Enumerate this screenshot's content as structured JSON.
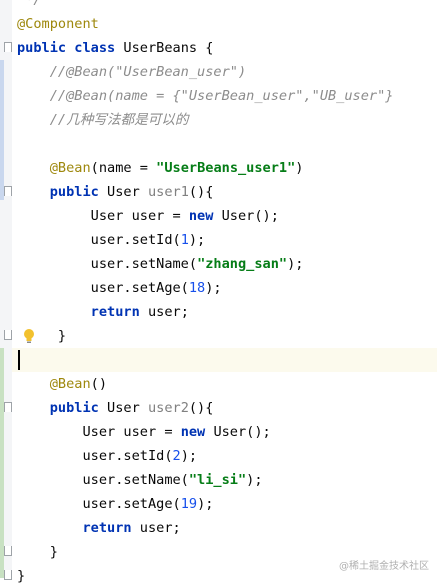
{
  "editor": {
    "lines": [
      [
        {
          "t": " */",
          "c": "cm"
        }
      ],
      [
        {
          "t": "@Component",
          "c": "ann"
        }
      ],
      [
        {
          "t": "public ",
          "c": "kw"
        },
        {
          "t": "class ",
          "c": "kw"
        },
        {
          "t": "UserBeans {",
          "c": "pln"
        }
      ],
      [
        {
          "t": "    //@Bean(\"UserBean_user\")",
          "c": "cm"
        }
      ],
      [
        {
          "t": "    //@Bean(name = {\"UserBean_user\",\"UB_user\"}",
          "c": "cm"
        }
      ],
      [
        {
          "t": "    //几种写法都是可以的",
          "c": "cm"
        }
      ],
      [],
      [
        {
          "t": "    @Bean",
          "c": "ann"
        },
        {
          "t": "(name = ",
          "c": "pln"
        },
        {
          "t": "\"UserBeans_user1\"",
          "c": "str"
        },
        {
          "t": ")",
          "c": "pln"
        }
      ],
      [
        {
          "t": "    public ",
          "c": "kw"
        },
        {
          "t": "User ",
          "c": "pln"
        },
        {
          "t": "user1",
          "c": "unused"
        },
        {
          "t": "(){",
          "c": "pln"
        }
      ],
      [
        {
          "t": "         User user = ",
          "c": "pln"
        },
        {
          "t": "new ",
          "c": "kw"
        },
        {
          "t": "User();",
          "c": "pln"
        }
      ],
      [
        {
          "t": "         user.setId(",
          "c": "pln"
        },
        {
          "t": "1",
          "c": "num"
        },
        {
          "t": ");",
          "c": "pln"
        }
      ],
      [
        {
          "t": "         user.setName(",
          "c": "pln"
        },
        {
          "t": "\"zhang_san\"",
          "c": "str"
        },
        {
          "t": ");",
          "c": "pln"
        }
      ],
      [
        {
          "t": "         user.setAge(",
          "c": "pln"
        },
        {
          "t": "18",
          "c": "num"
        },
        {
          "t": ");",
          "c": "pln"
        }
      ],
      [
        {
          "t": "         return ",
          "c": "kw"
        },
        {
          "t": "user;",
          "c": "pln"
        }
      ],
      [
        {
          "t": "     }",
          "c": "pln"
        }
      ],
      [],
      [
        {
          "t": "    @Bean",
          "c": "ann"
        },
        {
          "t": "()",
          "c": "pln"
        }
      ],
      [
        {
          "t": "    public ",
          "c": "kw"
        },
        {
          "t": "User ",
          "c": "pln"
        },
        {
          "t": "user2",
          "c": "unused"
        },
        {
          "t": "(){",
          "c": "pln"
        }
      ],
      [
        {
          "t": "        User user = ",
          "c": "pln"
        },
        {
          "t": "new ",
          "c": "kw"
        },
        {
          "t": "User();",
          "c": "pln"
        }
      ],
      [
        {
          "t": "        user.setId(",
          "c": "pln"
        },
        {
          "t": "2",
          "c": "num"
        },
        {
          "t": ");",
          "c": "pln"
        }
      ],
      [
        {
          "t": "        user.setName(",
          "c": "pln"
        },
        {
          "t": "\"li_si\"",
          "c": "str"
        },
        {
          "t": ");",
          "c": "pln"
        }
      ],
      [
        {
          "t": "        user.setAge(",
          "c": "pln"
        },
        {
          "t": "19",
          "c": "num"
        },
        {
          "t": ");",
          "c": "pln"
        }
      ],
      [
        {
          "t": "        return ",
          "c": "kw"
        },
        {
          "t": "user;",
          "c": "pln"
        }
      ],
      [
        {
          "t": "    }",
          "c": "pln"
        }
      ],
      [
        {
          "t": "}",
          "c": "pln"
        }
      ]
    ],
    "caret_line_index": 15,
    "intention_bulb_line_index": 14
  },
  "icons": {
    "gutter_fold": "fold-marker-icon",
    "intention": "lightbulb-icon"
  },
  "colors": {
    "keyword": "#0033b3",
    "annotation": "#9e880d",
    "comment": "#8c8c8c",
    "string": "#067d17",
    "number": "#1750eb",
    "unused": "#808080",
    "vcs_changed": "#c9d7ee",
    "vcs_added": "#c8e1c2",
    "caret_line": "#fcfaed"
  },
  "watermark": "@稀土掘金技术社区"
}
